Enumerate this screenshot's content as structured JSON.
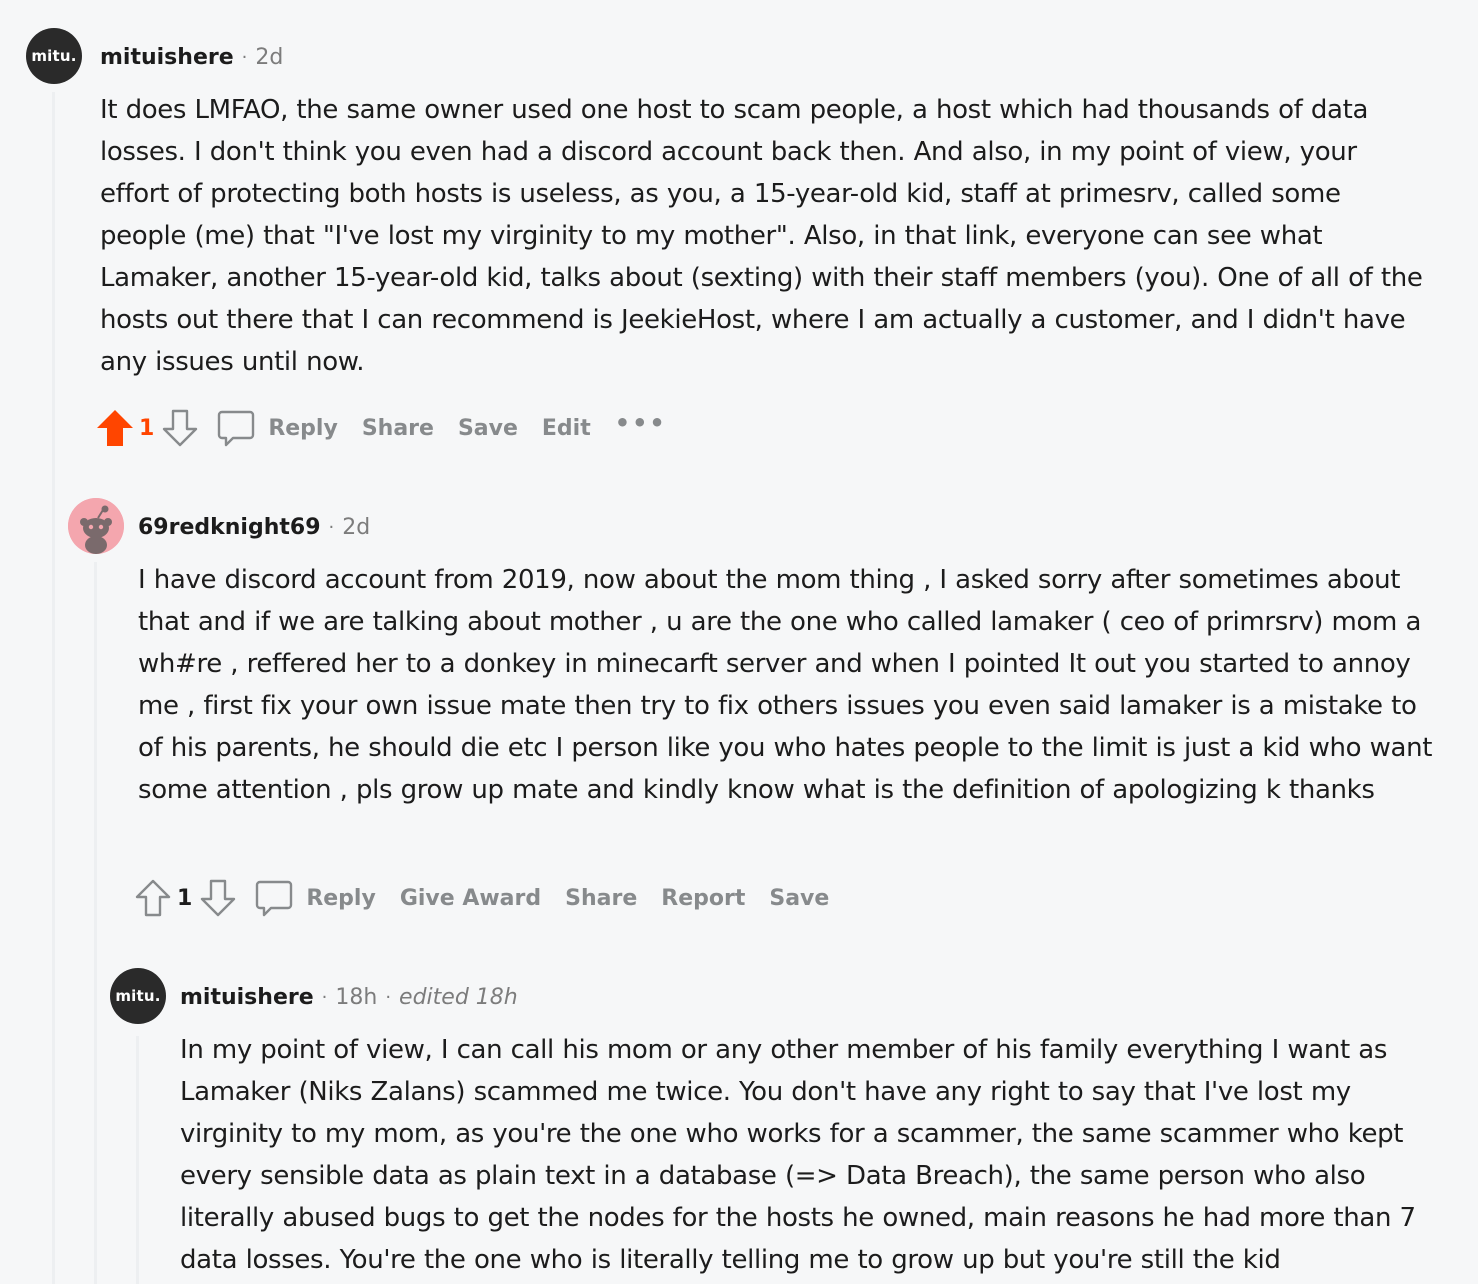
{
  "comments": [
    {
      "username": "mituishere",
      "time": "2d",
      "avatar_text": "mitu.",
      "body": "It does LMFAO, the same owner used one host to scam people, a host which had thousands of data losses. I don't think you even had a discord account back then. And also, in my point of view, your effort of protecting both hosts is useless, as you, a 15-year-old kid, staff at primesrv, called some people (me) that \"I've lost my virginity to my mother\". Also, in that link, everyone can see what Lamaker, another 15-year-old kid, talks about (sexting) with their staff members (you). One of all of the hosts out there that I can recommend is JeekieHost, where I am actually a customer, and I didn't have any issues until now.",
      "votes": "1",
      "upvoted": true,
      "actions": {
        "reply": "Reply",
        "share": "Share",
        "save": "Save",
        "edit": "Edit",
        "more": "•••"
      }
    },
    {
      "username": "69redknight69",
      "time": "2d",
      "body": "I have discord account from 2019, now about the mom thing , I asked sorry after sometimes about that and if we are talking about mother , u are the one who called lamaker ( ceo of primrsrv) mom a wh#re , reffered her to a donkey in minecarft server and when I pointed It out you started to annoy me , first fix your own issue mate then try to fix others issues you even said lamaker is a mistake to of his parents, he should die etc I person like you who hates people to the limit is just a kid who want some attention , pls grow up mate and kindly know what is the definition of apologizing k thanks",
      "votes": "1",
      "upvoted": false,
      "actions": {
        "reply": "Reply",
        "give_award": "Give Award",
        "share": "Share",
        "report": "Report",
        "save": "Save"
      }
    },
    {
      "username": "mituishere",
      "time": "18h",
      "edited": "edited 18h",
      "avatar_text": "mitu.",
      "body": "In my point of view, I can call his mom or any other member of his family everything I want as Lamaker (Niks Zalans) scammed me twice. You don't have any right to say that I've lost my virginity to my mom, as you're the one who works for a scammer, the same scammer who kept every sensible data as plain text in a database (=> Data Breach), the same person who also literally abused bugs to get the nodes for the hosts he owned, main reasons he had more than 7 data losses. You're the one who is literally telling me to grow up but you're still the kid"
    }
  ],
  "colors": {
    "upvote": "#ff4500",
    "action_gray": "#878a8c",
    "background": "#f6f7f8"
  }
}
